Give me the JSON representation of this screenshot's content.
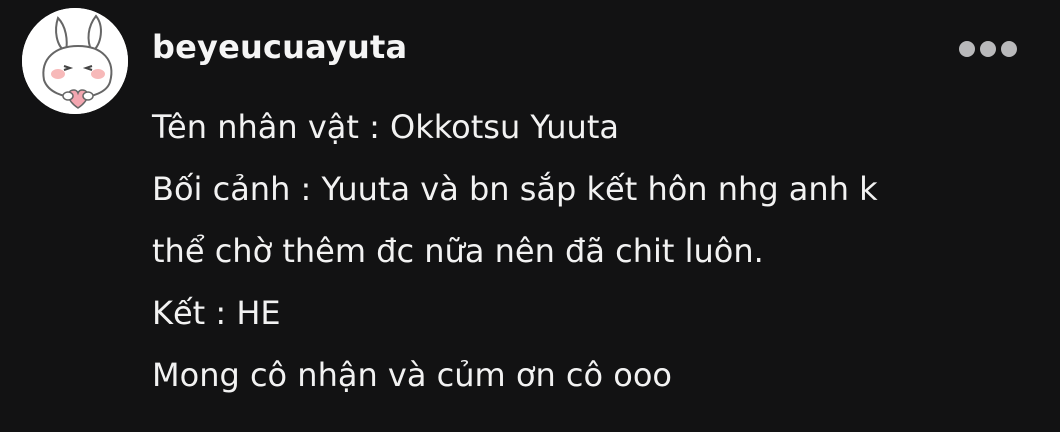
{
  "post": {
    "author": {
      "username": "beyeucuayuta",
      "avatar_icon": "bunny-holding-heart-icon"
    },
    "more_icon": "more-horizontal-icon",
    "message_lines": [
      "Tên nhân vật : Okkotsu Yuuta",
      "Bối cảnh : Yuuta và bn sắp kết hôn nhg anh k",
      "thể chờ thêm đc nữa nên đã chit luôn.",
      "Kết : HE",
      "Mong cô nhận và củm ơn cô ooo"
    ]
  },
  "colors": {
    "background": "#121213",
    "text": "#f2f2f2",
    "more_dots": "#b9b9bb"
  }
}
